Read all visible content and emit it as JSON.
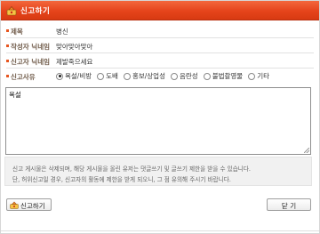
{
  "window": {
    "title": "신고하기",
    "accent": "#e5441b"
  },
  "fields": {
    "subject": {
      "label": "제목",
      "value": "병신"
    },
    "author_nick": {
      "label": "작성자 닉네임",
      "value": "맞아맞아맞아"
    },
    "reporter_nick": {
      "label": "신고자 닉네임",
      "value": "제발죽으세요"
    },
    "reason": {
      "label": "신고사유",
      "options": [
        "욕설/비방",
        "도배",
        "홍보/상업성",
        "음란성",
        "불법촬영물",
        "기타"
      ],
      "selected": "욕설/비방"
    }
  },
  "detail": {
    "value": "욕설"
  },
  "notice": {
    "line1": "신고 게시물은 삭제되며, 해당 게시물을 올린 유저는 댓글쓰기 및 글쓰기 제한을 받을 수 있습니다.",
    "line2": "단, 허위신고일 경우, 신고자의 활동에 제한을 받게 되오니, 그 점 유의해 주시기 바랍니다."
  },
  "buttons": {
    "report": "신고하기",
    "close": "닫 기"
  },
  "icons": {
    "title": "report-icon",
    "report_button": "report-icon"
  }
}
